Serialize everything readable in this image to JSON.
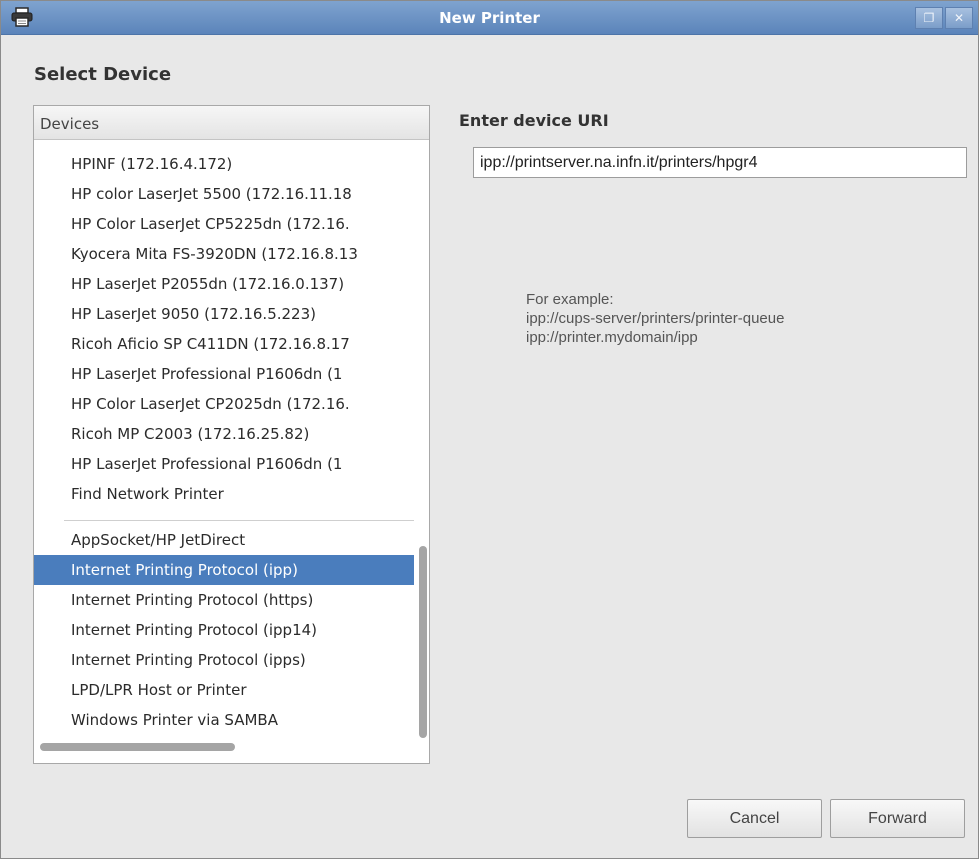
{
  "window": {
    "title": "New Printer",
    "restore_glyph": "❐",
    "close_glyph": "✕"
  },
  "section_title": "Select Device",
  "devices": {
    "header": "Devices",
    "items": [
      "HPINF (172.16.4.172)",
      "HP color LaserJet 5500 (172.16.11.18",
      "HP Color LaserJet CP5225dn (172.16.",
      "Kyocera Mita FS-3920DN (172.16.8.13",
      "HP LaserJet P2055dn (172.16.0.137)",
      "HP LaserJet 9050 (172.16.5.223)",
      "Ricoh Aficio SP C411DN (172.16.8.17",
      "HP LaserJet Professional P1606dn (1",
      "HP Color LaserJet CP2025dn (172.16.",
      "Ricoh MP C2003 (172.16.25.82)",
      "HP LaserJet Professional P1606dn (1",
      "Find Network Printer",
      "AppSocket/HP JetDirect",
      "Internet Printing Protocol (ipp)",
      "Internet Printing Protocol (https)",
      "Internet Printing Protocol (ipp14)",
      "Internet Printing Protocol (ipps)",
      "LPD/LPR Host or Printer",
      "Windows Printer via SAMBA"
    ],
    "selected": "Internet Printing Protocol (ipp)"
  },
  "uri": {
    "label": "Enter device URI",
    "value": "ipp://printserver.na.infn.it/printers/hpgr4",
    "example_heading": "For example:",
    "example_1": "ipp://cups-server/printers/printer-queue",
    "example_2": "ipp://printer.mydomain/ipp"
  },
  "buttons": {
    "cancel": "Cancel",
    "forward": "Forward"
  },
  "colors": {
    "titlebar": "#6a91c4",
    "selection": "#4a7dbd"
  },
  "icons": {
    "app": "printer-icon"
  }
}
